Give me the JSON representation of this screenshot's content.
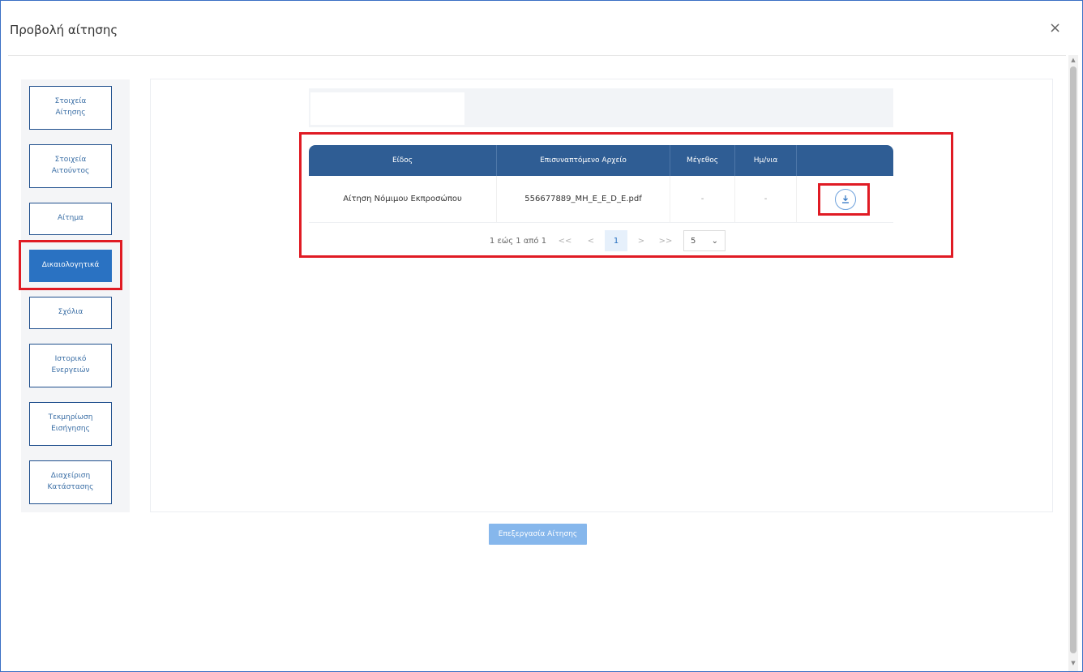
{
  "dialog": {
    "title": "Προβολή αίτησης",
    "close_label": "×"
  },
  "sidebar": {
    "items": [
      {
        "label": "Στοιχεία\nΑίτησης"
      },
      {
        "label": "Στοιχεία\nΑιτούντος"
      },
      {
        "label": "Αίτημα"
      },
      {
        "label": "Δικαιολογητικά",
        "active": true
      },
      {
        "label": "Σχόλια"
      },
      {
        "label": "Ιστορικό\nΕνεργειών"
      },
      {
        "label": "Τεκμηρίωση\nΕισήγησης"
      },
      {
        "label": "Διαχείριση\nΚατάστασης"
      }
    ]
  },
  "table": {
    "headers": [
      "Είδος",
      "Επισυναπτόμενο Αρχείο",
      "Μέγεθος",
      "Ημ/νια",
      ""
    ],
    "rows": [
      {
        "type": "Αίτηση Νόμιμου Εκπροσώπου",
        "file": "556677889_MH_E_E_D_E.pdf",
        "size": "-",
        "date": "-",
        "download_icon": "download-icon"
      }
    ]
  },
  "pagination": {
    "summary": "1 εώς 1 από 1",
    "first": "<<",
    "prev": "<",
    "current": "1",
    "next": ">",
    "last": ">>",
    "page_size": "5",
    "page_size_chevron": "⌄"
  },
  "actions": {
    "process_label": "Επεξεργασία Αίτησης"
  },
  "scrollbar": {
    "up": "▲",
    "down": "▼"
  },
  "colors": {
    "primary": "#2a72c2",
    "header": "#2f5d94",
    "highlight": "#e01b24"
  }
}
